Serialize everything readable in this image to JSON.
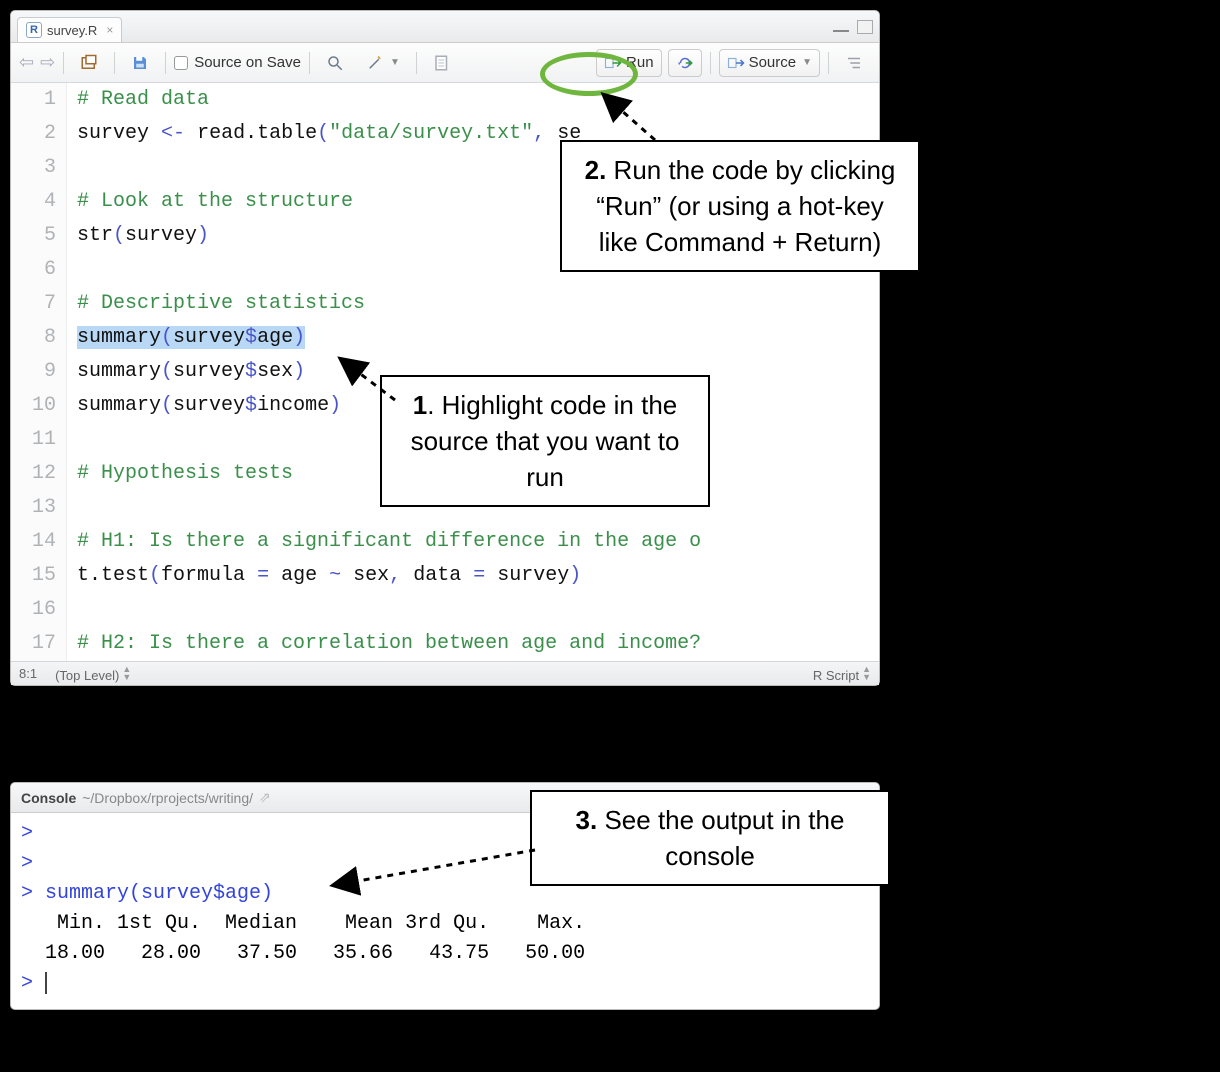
{
  "tab": {
    "filename": "survey.R",
    "badge": "R"
  },
  "toolbar": {
    "source_on_save": "Source on Save",
    "run": "Run",
    "source": "Source"
  },
  "code": {
    "lines": [
      {
        "n": 1,
        "type": "comment",
        "text": "# Read data"
      },
      {
        "n": 2,
        "type": "code",
        "raw": "survey <- read.table(\"data/survey.txt\", se"
      },
      {
        "n": 3,
        "type": "blank",
        "text": ""
      },
      {
        "n": 4,
        "type": "comment",
        "text": "# Look at the structure"
      },
      {
        "n": 5,
        "type": "code",
        "raw": "str(survey)"
      },
      {
        "n": 6,
        "type": "blank",
        "text": ""
      },
      {
        "n": 7,
        "type": "comment",
        "text": "# Descriptive statistics"
      },
      {
        "n": 8,
        "type": "code-hl",
        "raw": "summary(survey$age)"
      },
      {
        "n": 9,
        "type": "code",
        "raw": "summary(survey$sex)"
      },
      {
        "n": 10,
        "type": "code",
        "raw": "summary(survey$income)"
      },
      {
        "n": 11,
        "type": "blank",
        "text": ""
      },
      {
        "n": 12,
        "type": "comment",
        "text": "# Hypothesis tests"
      },
      {
        "n": 13,
        "type": "blank",
        "text": ""
      },
      {
        "n": 14,
        "type": "comment",
        "text": "# H1: Is there a significant difference in the age o"
      },
      {
        "n": 15,
        "type": "code",
        "raw": "t.test(formula = age ~ sex, data = survey)"
      },
      {
        "n": 16,
        "type": "blank",
        "text": ""
      },
      {
        "n": 17,
        "type": "comment",
        "text": "# H2: Is there a correlation between age and income?"
      }
    ]
  },
  "status": {
    "cursor": "8:1",
    "scope": "(Top Level)",
    "filetype": "R Script"
  },
  "console": {
    "title": "Console",
    "path": "~/Dropbox/rprojects/writing/",
    "command": "summary(survey$age)",
    "headers": "   Min. 1st Qu.  Median    Mean 3rd Qu.    Max. ",
    "values": "  18.00   28.00   37.50   35.66   43.75   50.00 "
  },
  "callouts": {
    "c1_num": "1",
    "c1_text": ". Highlight code in the source that you want to run",
    "c2_num": "2.",
    "c2_text": " Run the code by clicking “Run” (or using a hot-key like Command + Return)",
    "c3_num": "3.",
    "c3_text": " See the output in the console"
  }
}
